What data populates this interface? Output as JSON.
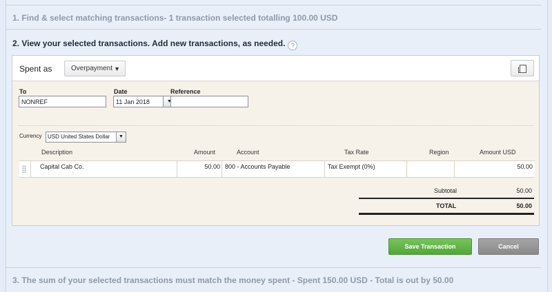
{
  "steps": {
    "step1": "1. Find & select matching transactions- 1 transaction selected totalling 100.00 USD",
    "step2": "2. View your selected transactions. Add new transactions, as needed.",
    "step2_help": "?",
    "step3": "3. The sum of your selected transactions must match the money spent - Spent 150.00 USD - Total is out by 50.00"
  },
  "panel": {
    "spent_as_label": "Spent as",
    "spent_as_value": "Overpayment",
    "caret": "▼",
    "copy_icon": "copy-icon"
  },
  "form": {
    "to_label": "To",
    "to_value": "NONREF",
    "date_label": "Date",
    "date_value": "11 Jan 2018",
    "calendar_icon": "▼",
    "reference_label": "Reference",
    "reference_value": "",
    "currency_label": "Currency",
    "currency_value": "USD United States Dollar"
  },
  "table": {
    "headers": {
      "description": "Description",
      "amount": "Amount",
      "account": "Account",
      "tax_rate": "Tax Rate",
      "region": "Region",
      "amount_usd": "Amount USD"
    },
    "rows": [
      {
        "description": "Capital Cab Co.",
        "amount": "50.00",
        "account": "800 - Accounts Payable",
        "tax_rate": "Tax Exempt (0%)",
        "region": "",
        "amount_usd": "50.00"
      }
    ],
    "subtotal_label": "Subtotal",
    "subtotal_value": "50.00",
    "total_label": "TOTAL",
    "total_value": "50.00"
  },
  "buttons": {
    "save": "Save Transaction",
    "cancel": "Cancel"
  },
  "colors": {
    "save_green": "#5cb044",
    "cancel_gray": "#999999",
    "background": "#e8eff9"
  }
}
